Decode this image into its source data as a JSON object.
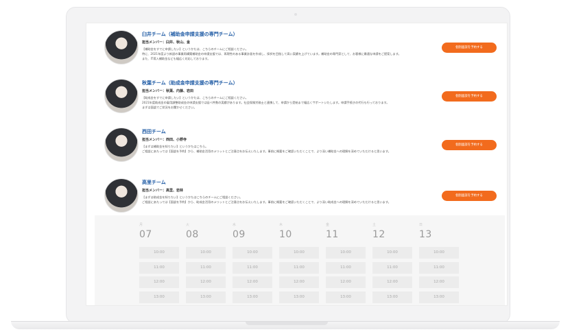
{
  "teams": [
    {
      "name": "臼井チーム（補助金申請支援の専門チーム）",
      "members": "担当メンバー：臼井、秋山、金",
      "description": "【補助金をすでに申請したい】というかたは、こちらのチームにご相談ください。\n特に、2021年度より新設の事業再構築補助金の申請支援では、再現性のある事業計画を作成し、採択を目指して高い実績を上げています。補助金の専門家として、お客様に最適な申請をご提案します。\nまた、IT導入補助金なども幅広く対応しております。",
      "button": "個別面談を予約する"
    },
    {
      "name": "秋葉チーム（助成金申請支援の専門チーム）",
      "members": "担当メンバー：秋葉、内藤、岩田",
      "description": "【助成金をすでに申請したい】というかたは、こちらのチームにご相談ください。\n2021年度助成金の雇用調整助成金の申請支援では延べ件数の実績があります。社会保険労務士と連携して、申請から受給まで幅広くサポートいたします。申請手続きの代行も行っております。\nまずは面談でご状況をお聞かせください。",
      "button": "個別面談を予約する"
    },
    {
      "name": "西田チーム",
      "members": "担当メンバー：西田、小野寺",
      "description": "【まずは補助金を知りたい】というかたはこちら。\nご相談にあたっては【面談を予約】から、補助金活用のメリットとご注意点をお伝えいたします。事前に概要をご確認いただくことで、より深い補助金への理解を深めていただけると思います。",
      "button": "個別面談を予約する"
    },
    {
      "name": "高里チーム",
      "members": "担当メンバー：高里、岩林",
      "description": "【まずは助成金を知りたい】というかたはこちらのチームにご相談ください。\nご相談にあたっては【面談を予約】から、助成金活用のメリットとご注意点をお伝えいたします。事前に概要をご確認いただくことで、より深い助成金への理解を深めていただけると思います。",
      "button": "個別面談を予約する"
    }
  ],
  "calendar": {
    "days": [
      {
        "dow": "月",
        "date": "07"
      },
      {
        "dow": "火",
        "date": "08"
      },
      {
        "dow": "水",
        "date": "09"
      },
      {
        "dow": "木",
        "date": "10"
      },
      {
        "dow": "金",
        "date": "11"
      },
      {
        "dow": "土",
        "date": "12"
      },
      {
        "dow": "日",
        "date": "13"
      }
    ],
    "times": [
      "10:00",
      "11:00",
      "12:00",
      "13:00"
    ]
  },
  "colors": {
    "accent": "#f26b1d",
    "title": "#1f5ba5"
  }
}
